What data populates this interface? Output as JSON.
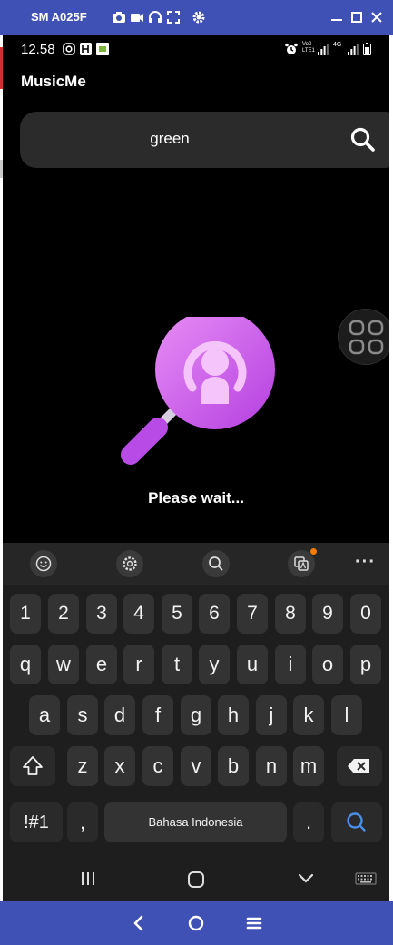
{
  "emulator": {
    "title": "SM A025F",
    "toolbar_icons": [
      "camera-icon",
      "video-icon",
      "headset-icon",
      "fullscreen-icon",
      "settings-icon"
    ],
    "window_controls": [
      "minimize-icon",
      "maximize-icon",
      "close-icon"
    ],
    "nav_buttons": [
      "back-icon",
      "home-icon",
      "menu-icon"
    ],
    "bar_color": "#3f51b5"
  },
  "statusbar": {
    "time": "12.58",
    "left_icons": [
      "instagram-icon",
      "app-icon",
      "image-icon"
    ],
    "right_icons": [
      "alarm-icon",
      "volte-icon",
      "signal-icon",
      "4g-icon",
      "signal-icon",
      "battery-icon"
    ],
    "vo_label": "Vo0",
    "lte_label": "LTE1",
    "net_label": "4G"
  },
  "app": {
    "title": "MusicMe",
    "search": {
      "value": "green"
    },
    "loading_text": "Please wait...",
    "accent": "#c04ee6"
  },
  "keyboard": {
    "toolbar": [
      "emoji-icon",
      "settings-icon",
      "search-icon",
      "translate-icon"
    ],
    "more": "···",
    "row_numbers": [
      "1",
      "2",
      "3",
      "4",
      "5",
      "6",
      "7",
      "8",
      "9",
      "0"
    ],
    "row_1": [
      "q",
      "w",
      "e",
      "r",
      "t",
      "y",
      "u",
      "i",
      "o",
      "p"
    ],
    "row_2": [
      "a",
      "s",
      "d",
      "f",
      "g",
      "h",
      "j",
      "k",
      "l"
    ],
    "row_3": [
      "z",
      "x",
      "c",
      "v",
      "b",
      "n",
      "m"
    ],
    "symbols_key": "!#1",
    "comma_key": ",",
    "space_label": "Bahasa Indonesia",
    "period_key": ".",
    "search_key_color": "#4a8fe7"
  }
}
